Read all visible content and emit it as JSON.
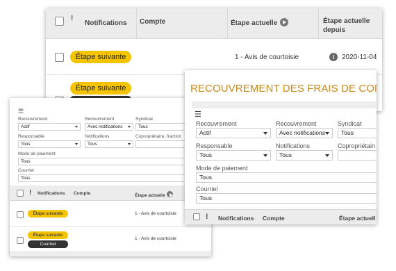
{
  "back": {
    "headers": {
      "alert_glyph": "!",
      "notifications": "Notifications",
      "compte": "Compte",
      "etape": "Étape actuelle",
      "depuis_1": "Étape actuelle",
      "depuis_2": "depuis"
    },
    "rows": [
      {
        "pill": "Étape suivante",
        "step": "1 - Avis de courtoisie",
        "date": "2020-11-04"
      },
      {
        "pill": "Étape suivante"
      }
    ]
  },
  "left": {
    "filters": {
      "recouvrement_label": "Recouvrement",
      "recouvrement_value": "Actif",
      "recouvrement2_label": "Recouvrement",
      "recouvrement2_value": "Avec notifications",
      "syndicat_label": "Syndicat",
      "syndicat_value": "Tous",
      "responsable_label": "Responsable",
      "responsable_value": "Tous",
      "notifications_label": "Notifications",
      "notifications_value": "Tous",
      "coproprietaire_label": "Copropriétaire, fraction",
      "paiement_label": "Mode de paiement",
      "paiement_value": "Tous",
      "courriel_label": "Courriel",
      "courriel_value": "Tous"
    },
    "headers": {
      "alert_glyph": "!",
      "notifications": "Notifications",
      "compte": "Compte",
      "etape": "Étape actuelle"
    },
    "rows": [
      {
        "pill": "Étape suivante",
        "step": "1 - Avis de courtoisie"
      },
      {
        "pill": "Étape suivante",
        "pill2": "Courriel",
        "step": "1 - Avis de courtoisie"
      }
    ]
  },
  "front": {
    "title": "RECOUVREMENT DES FRAIS DE CONDO",
    "filters": {
      "recouvrement_label": "Recouvrement",
      "recouvrement_value": "Actif",
      "recouvrement2_label": "Recouvrement",
      "recouvrement2_value": "Avec notifications",
      "syndicat_label": "Syndicat",
      "syndicat_value": "Tous",
      "responsable_label": "Responsable",
      "responsable_value": "Tous",
      "notifications_label": "Notifications",
      "notifications_value": "Tous",
      "coproprietaire_label": "Copropriétain",
      "paiement_label": "Mode de paiement",
      "paiement_value": "Tous",
      "courriel_label": "Courriel",
      "courriel_value": "Tous"
    },
    "headers": {
      "notifications": "Notifications",
      "compte": "Compte",
      "etape": "Étape actuell"
    }
  },
  "icons": {
    "menu": "filter-menu-icon",
    "play": "play-icon",
    "info": "info-icon",
    "dropdown": "chevron-down-icon"
  },
  "colors": {
    "pill_yellow": "#f5c400",
    "pill_dark": "#333333",
    "title_gold": "#c68a1a"
  }
}
